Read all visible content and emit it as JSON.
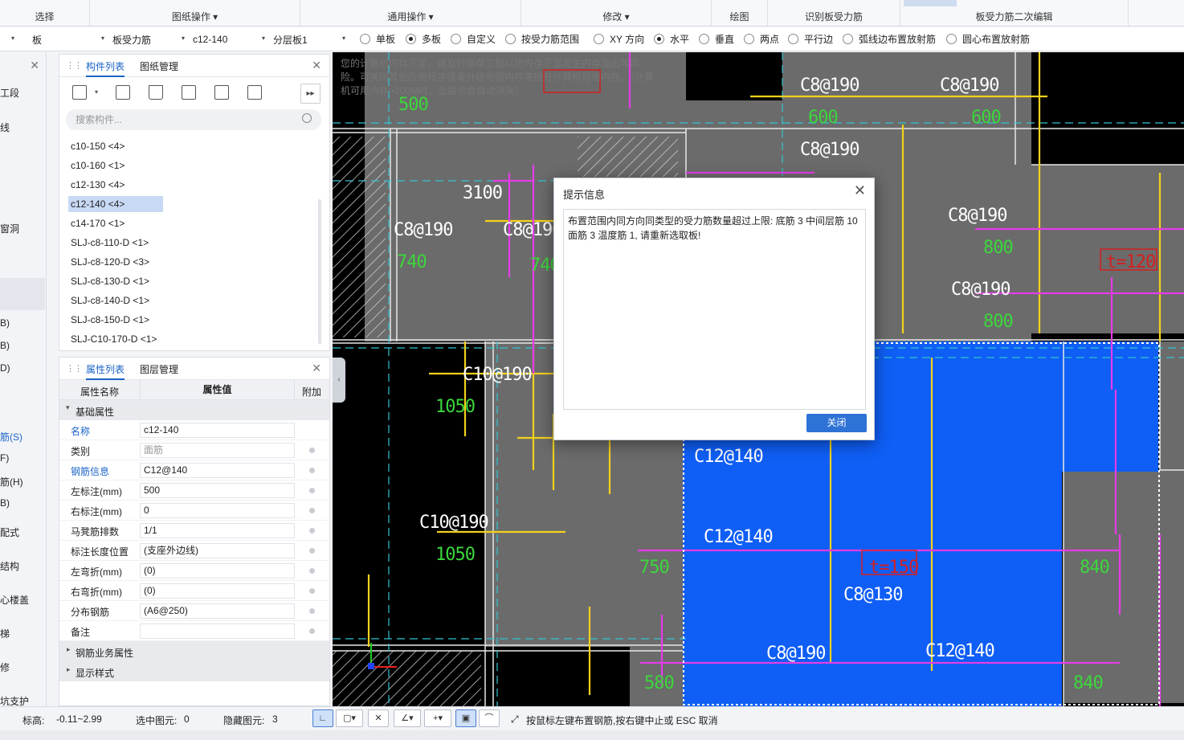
{
  "ribbon": {
    "groups": [
      "选择",
      "图纸操作",
      "通用操作",
      "修改",
      "绘图",
      "识别板受力筋",
      "板受力筋二次编辑"
    ]
  },
  "optbar": {
    "selects": [
      "板",
      "板受力筋",
      "c12-140",
      "分层板1"
    ],
    "radios": [
      {
        "label": "单板",
        "checked": false
      },
      {
        "label": "多板",
        "checked": true
      },
      {
        "label": "自定义",
        "checked": false
      },
      {
        "label": "按受力筋范围",
        "checked": false
      },
      {
        "label": "XY 方向",
        "checked": false
      },
      {
        "label": "水平",
        "checked": true
      },
      {
        "label": "垂直",
        "checked": false
      },
      {
        "label": "两点",
        "checked": false
      },
      {
        "label": "平行边",
        "checked": false
      },
      {
        "label": "弧线边布置放射筋",
        "checked": false
      },
      {
        "label": "圆心布置放射筋",
        "checked": false
      }
    ]
  },
  "leftnav": [
    "工段",
    "线",
    "窗洞",
    "B)",
    "B)",
    "D)",
    "筋(S)",
    "F)",
    "筋(H)",
    "B)",
    "配式",
    "结构",
    "心楼盖",
    "梯",
    "修",
    "坑支护"
  ],
  "component_panel": {
    "tabs": [
      "构件列表",
      "图纸管理"
    ],
    "search_placeholder": "搜索构件...",
    "items": [
      "c10-150 <4>",
      "c10-160 <1>",
      "c12-130 <4>",
      "c12-140 <4>",
      "c14-170 <1>",
      "SLJ-c8-110-D <1>",
      "SLJ-c8-120-D <3>",
      "SLJ-c8-130-D <1>",
      "SLJ-c8-140-D <1>",
      "SLJ-c8-150-D <1>",
      "SLJ-C10-170-D <1>"
    ],
    "selected_index": 3
  },
  "property_panel": {
    "tabs": [
      "属性列表",
      "图层管理"
    ],
    "header": {
      "name": "属性名称",
      "value": "属性值",
      "extra": "附加"
    },
    "section": "基础属性",
    "rows": [
      {
        "name": "名称",
        "value": "c12-140",
        "blue": true
      },
      {
        "name": "类别",
        "value": "面筋",
        "blue": false,
        "gray": true
      },
      {
        "name": "钢筋信息",
        "value": "C12@140",
        "blue": true
      },
      {
        "name": "左标注(mm)",
        "value": "500",
        "blue": false
      },
      {
        "name": "右标注(mm)",
        "value": "0",
        "blue": false
      },
      {
        "name": "马凳筋排数",
        "value": "1/1",
        "blue": false
      },
      {
        "name": "标注长度位置",
        "value": "(支座外边线)",
        "blue": false
      },
      {
        "name": "左弯折(mm)",
        "value": "(0)",
        "blue": false
      },
      {
        "name": "右弯折(mm)",
        "value": "(0)",
        "blue": false
      },
      {
        "name": "分布钢筋",
        "value": "(A6@250)",
        "blue": false
      },
      {
        "name": "备注",
        "value": "",
        "blue": false
      }
    ],
    "collapsed": [
      "钢筋业务属性",
      "显示样式"
    ]
  },
  "canvas": {
    "hint": "您的计算机内存不足，请及时保存工程以防内存不足发生内存溢出等风险。可关闭其他应用程序或者升级电脑内存来提升计算机可用内存。（计算机可用内存>200M时，此提示会自动消失）",
    "labels": [
      {
        "t": "C8@190",
        "c": "#ffffff"
      },
      {
        "t": "C8@190",
        "c": "#ffffff"
      },
      {
        "t": "600",
        "c": "#3cd63c"
      },
      {
        "t": "600",
        "c": "#3cd63c"
      },
      {
        "t": "C8@190",
        "c": "#ffffff"
      },
      {
        "t": "3100",
        "c": "#ffffff"
      },
      {
        "t": "C8@190",
        "c": "#ffffff"
      },
      {
        "t": "C8@190",
        "c": "#ffffff"
      },
      {
        "t": "740",
        "c": "#3cd63c"
      },
      {
        "t": "740",
        "c": "#3cd63c"
      },
      {
        "t": "C8@190",
        "c": "#ffffff"
      },
      {
        "t": "800",
        "c": "#3cd63c"
      },
      {
        "t": "t=120",
        "c": "#d32020"
      },
      {
        "t": "C8@190",
        "c": "#ffffff"
      },
      {
        "t": "800",
        "c": "#3cd63c"
      },
      {
        "t": "C10@190",
        "c": "#ffffff"
      },
      {
        "t": "1050",
        "c": "#3cd63c"
      },
      {
        "t": "C12@140",
        "c": "#ffffff"
      },
      {
        "t": "C12@140",
        "c": "#ffffff"
      },
      {
        "t": "C10@190",
        "c": "#ffffff"
      },
      {
        "t": "1050",
        "c": "#3cd63c"
      },
      {
        "t": "750",
        "c": "#3cd63c"
      },
      {
        "t": "t=150",
        "c": "#d32020"
      },
      {
        "t": "C8@130",
        "c": "#ffffff"
      },
      {
        "t": "840",
        "c": "#3cd63c"
      },
      {
        "t": "C12@140",
        "c": "#ffffff"
      },
      {
        "t": "580",
        "c": "#3cd63c"
      },
      {
        "t": "840",
        "c": "#3cd63c"
      },
      {
        "t": "500",
        "c": "#3cd63c"
      },
      {
        "t": "C8@190",
        "c": "#ffffff"
      }
    ]
  },
  "dialog": {
    "title": "提示信息",
    "message": "布置范围内同方向同类型的受力筋数量超过上限: 底筋 3 中间层筋 10 面筋 3 温度筋 1, 请重新选取板!",
    "close_label": "关闭"
  },
  "status": {
    "elevation_label": "标高:",
    "elevation_value": "-0.11~2.99",
    "selected_label": "选中图元:",
    "selected_value": "0",
    "hidden_label": "隐藏图元:",
    "hidden_value": "3",
    "instruction": "按鼠标左键布置钢筋,按右键中止或 ESC 取消"
  }
}
